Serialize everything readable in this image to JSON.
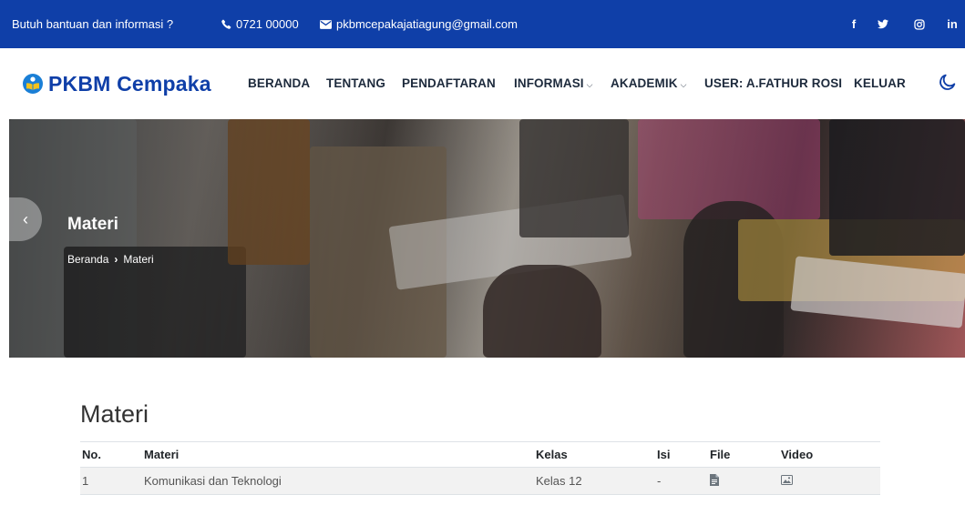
{
  "topbar": {
    "help_text": "Butuh bantuan dan informasi ?",
    "phone": "0721 00000",
    "email": "pkbmcepakajatiagung@gmail.com",
    "social": [
      {
        "icon": "facebook-icon",
        "label": "f"
      },
      {
        "icon": "twitter-icon",
        "label": "𝕥"
      },
      {
        "icon": "instagram-icon",
        "label": "◎"
      },
      {
        "icon": "linkedin-icon",
        "label": "in"
      }
    ],
    "background_color": "#0f3fa8"
  },
  "navbar": {
    "brand": "PKBM Cempaka",
    "items": [
      {
        "label": "BERANDA"
      },
      {
        "label": "TENTANG"
      },
      {
        "label": "PENDAFTARAN"
      },
      {
        "label": "INFORMASI",
        "dropdown": true
      },
      {
        "label": "AKADEMIK",
        "dropdown": true
      },
      {
        "label": "USER: A.FATHUR ROSI"
      },
      {
        "label": "KELUAR"
      }
    ],
    "theme_toggle_icon": "moon-icon"
  },
  "hero": {
    "title": "Materi",
    "breadcrumb": [
      "Beranda",
      "Materi"
    ],
    "breadcrumb_separator": "›"
  },
  "content": {
    "title": "Materi",
    "table": {
      "headers": [
        "No.",
        "Materi",
        "Kelas",
        "Isi",
        "File",
        "Video"
      ],
      "rows": [
        {
          "no": "1",
          "materi": "Komunikasi dan Teknologi",
          "kelas": "Kelas 12",
          "isi": "-",
          "file_icon": "file-icon",
          "video_icon": "image-icon"
        }
      ]
    }
  }
}
